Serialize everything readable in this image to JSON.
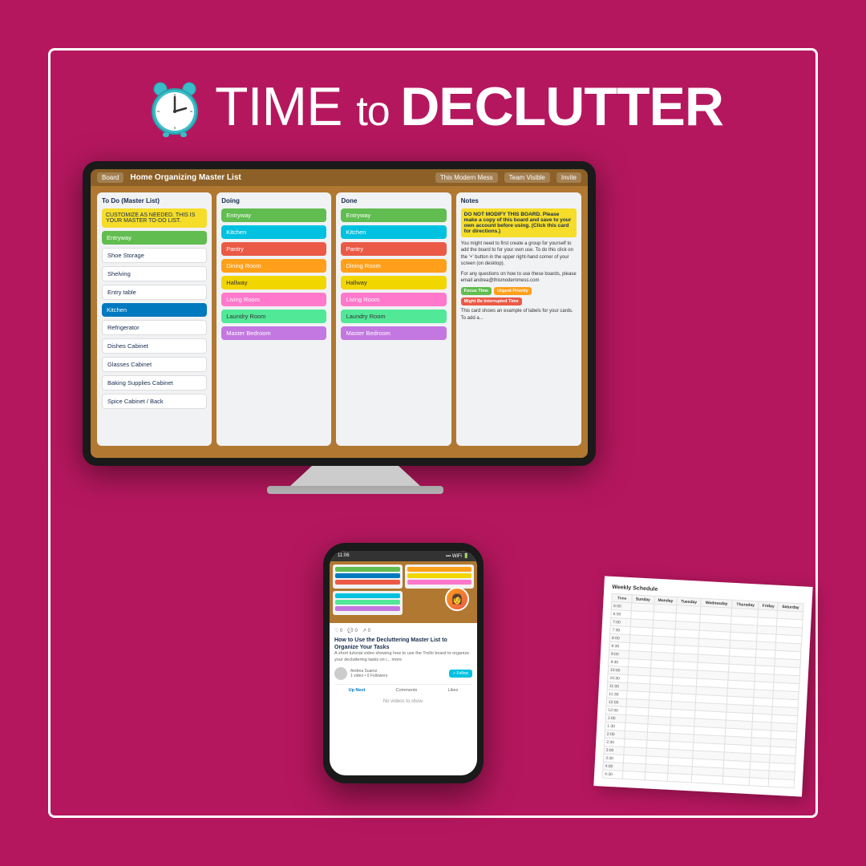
{
  "page": {
    "bg_color": "#b5175e",
    "border_color": "white"
  },
  "header": {
    "title_part1": "TIME ",
    "title_part2": "to ",
    "title_part3": "DECLUTTER"
  },
  "trello": {
    "board_name": "Home Organizing Master List",
    "nav_item": "Board",
    "team_name": "This Modern Mess",
    "visibility": "Team Visible",
    "invite_label": "Invite",
    "columns": [
      {
        "id": "todo",
        "header": "To Do (Master List)",
        "cards": [
          {
            "label": "CUSTOMIZE AS NEEDED. THIS IS YOUR MASTER TO-DO LIST.",
            "color": "yellow-text"
          },
          {
            "label": "Entryway",
            "color": "green"
          },
          {
            "label": "Shoe Storage",
            "color": "white-bg"
          },
          {
            "label": "Shelving",
            "color": "white-bg"
          },
          {
            "label": "Entry table",
            "color": "white-bg"
          },
          {
            "label": "Kitchen",
            "color": "blue"
          },
          {
            "label": "Refrigerator",
            "color": "white-bg"
          },
          {
            "label": "Dishes Cabinet",
            "color": "white-bg"
          },
          {
            "label": "Glasses Cabinet",
            "color": "white-bg"
          },
          {
            "label": "Baking Supplies Cabinet",
            "color": "white-bg"
          },
          {
            "label": "Spice Cabinet / Back",
            "color": "white-bg"
          }
        ]
      },
      {
        "id": "doing",
        "header": "Doing",
        "cards": [
          {
            "label": "Entryway",
            "color": "green"
          },
          {
            "label": "Kitchen",
            "color": "cyan"
          },
          {
            "label": "Pantry",
            "color": "red"
          },
          {
            "label": "Dining Room",
            "color": "orange"
          },
          {
            "label": "Hallway",
            "color": "yellow"
          },
          {
            "label": "Living Room",
            "color": "pink"
          },
          {
            "label": "Laundry Room",
            "color": "lime"
          },
          {
            "label": "Master Bedroom",
            "color": "purple"
          }
        ]
      },
      {
        "id": "done",
        "header": "Done",
        "cards": [
          {
            "label": "Entryway",
            "color": "green"
          },
          {
            "label": "Kitchen",
            "color": "cyan"
          },
          {
            "label": "Pantry",
            "color": "red"
          },
          {
            "label": "Dining Room",
            "color": "orange"
          },
          {
            "label": "Hallway",
            "color": "yellow"
          },
          {
            "label": "Living Room",
            "color": "pink"
          },
          {
            "label": "Laundry Room",
            "color": "lime"
          },
          {
            "label": "Master Bedroom",
            "color": "purple"
          }
        ]
      },
      {
        "id": "notes",
        "header": "Notes",
        "warning": "DO NOT MODIFY THIS BOARD. Please make a copy of this board and save to your own account before using. (Click this card for directions.)",
        "body1": "You might need to first create a group for yourself to add the board to for your own use. To do this click on the '+' button in the upper right-hand corner of your screen (on desktop).",
        "body2": "For any questions on how to use these boards, please email andrea@thismodernmess.com",
        "tags": [
          "Focus Time",
          "Urgent Priority",
          "Might Be Interrupted Time"
        ],
        "body3": "This card shows an example of labels for your cards. To add a..."
      }
    ]
  },
  "phone": {
    "status_time": "11:06",
    "video_title": "How to Use the Decluttering Master List to Organize Your Tasks",
    "description": "A short tutorial video showing how to use the Trello board to organize your decluttering tasks on i... more",
    "author_name": "Andrea Suarez",
    "author_followers": "1 video • 0 Followers",
    "follow_label": "+ Follow",
    "tabs": [
      "Up Next",
      "Comments",
      "Likes"
    ],
    "no_content": "No videos to show."
  },
  "schedule": {
    "title": "Weekly Schedule",
    "days": [
      "Sunday",
      "Monday",
      "Tuesday",
      "Wednesday",
      "Thursday",
      "Friday",
      "Saturday"
    ],
    "times": [
      "6:00",
      "6:30",
      "7:00",
      "7:30",
      "8:00",
      "8:30",
      "9:00",
      "9:30",
      "10:00",
      "10:30",
      "11:00",
      "11:30",
      "12:00",
      "12:30",
      "1:00",
      "1:30",
      "2:00",
      "2:30",
      "3:00",
      "3:30",
      "4:00",
      "4:30"
    ]
  }
}
